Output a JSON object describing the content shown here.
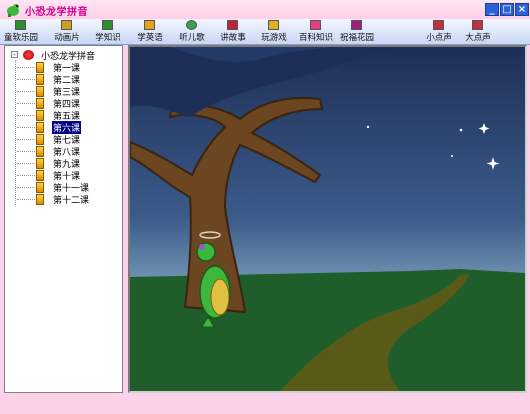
{
  "window": {
    "title": "小恐龙学拼音",
    "icon": "dinosaur-app-icon",
    "controls": {
      "minimize": "_",
      "maximize": "□",
      "close": "×"
    }
  },
  "toolbar": {
    "items": [
      {
        "label": "童软乐园",
        "icon": "home-icon",
        "color": "#2f8f2f"
      },
      {
        "label": "动画片",
        "icon": "film-icon",
        "color": "#d0a020"
      },
      {
        "label": "学知识",
        "icon": "book-icon",
        "color": "#2f8f2f"
      },
      {
        "label": "学英语",
        "icon": "english-icon",
        "color": "#e8a020"
      },
      {
        "label": "听儿歌",
        "icon": "music-icon",
        "color": "#3aa050"
      },
      {
        "label": "讲故事",
        "icon": "story-icon",
        "color": "#c0203a"
      },
      {
        "label": "玩游戏",
        "icon": "game-icon",
        "color": "#e0b020"
      },
      {
        "label": "百科知识",
        "icon": "encyclopedia-icon",
        "color": "#e04080"
      },
      {
        "label": "祝福花园",
        "icon": "garden-icon",
        "color": "#a02080"
      },
      {
        "label": "小点声",
        "icon": "volume-down-icon",
        "color": "#c03040"
      },
      {
        "label": "大点声",
        "icon": "volume-up-icon",
        "color": "#c03040"
      }
    ]
  },
  "tree": {
    "root_label": "小恐龙学拼音",
    "root_toggle": "-",
    "lessons": [
      "第一课",
      "第二课",
      "第三课",
      "第四课",
      "第五课",
      "第六课",
      "第七课",
      "第八课",
      "第九课",
      "第十课",
      "第十一课",
      "第十二课"
    ],
    "selected_index": 5
  },
  "colors": {
    "title_text": "#d2008c",
    "selection_bg": "#000080",
    "sky_top": "#243a66",
    "ground": "#1f5e2a",
    "path": "#5a5a18"
  }
}
